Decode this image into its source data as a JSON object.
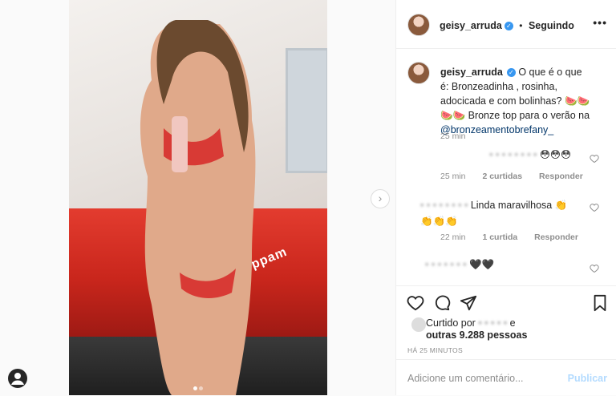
{
  "post": {
    "username": "geisy_arruda",
    "follow_status": "Seguindo",
    "more_glyph": "•••",
    "caption": {
      "username": "geisy_arruda",
      "text": "O que é o que é: Bronzeadinha , rosinha, adocicada e com bolinhas? 🍉🍉🍉🍉 Bronze top para o verão na",
      "mention": "@bronzeamentobrefany_",
      "time": "25 min"
    },
    "comments": [
      {
        "text": "😳😳😳",
        "time": "25 min",
        "likes": "2 curtidas",
        "reply": "Responder"
      },
      {
        "text": "Linda maravilhosa 👏 👏👏👏",
        "time": "22 min",
        "likes": "1 curtida",
        "reply": "Responder"
      },
      {
        "text": "🖤🖤",
        "time": "",
        "likes": "",
        "reply": ""
      }
    ],
    "liked_by_prefix": "Curtido por",
    "liked_by_suffix": "e",
    "liked_by_others": "outras 9.288 pessoas",
    "timestamp": "HÁ 25 MINUTOS",
    "add_comment_placeholder": "Adicione um comentário...",
    "publish_label": "Publicar"
  },
  "media": {
    "bed_text": "Keppam",
    "carousel_dots": 2,
    "active_dot": 0
  },
  "icons": {
    "like": "heart-icon",
    "comment": "comment-icon",
    "share": "share-icon",
    "save": "bookmark-icon",
    "next": "chevron-right-icon"
  },
  "colors": {
    "verified": "#3897f0",
    "publish_disabled": "#b3dbff",
    "meta": "#8e8e8e"
  }
}
